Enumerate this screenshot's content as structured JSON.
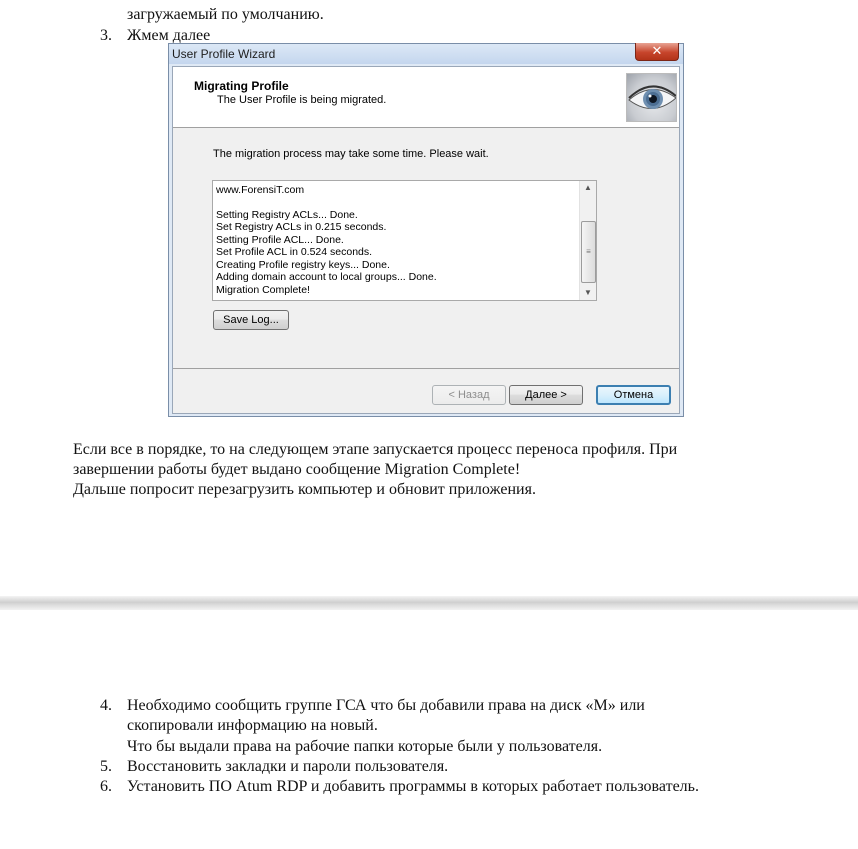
{
  "doc": {
    "top_partial_line": "загружаемый по умолчанию.",
    "step3": {
      "num": "3.",
      "text": "Жмем далее"
    },
    "para1": [
      "Если все в порядке, то на следующем этапе запускается процесс переноса профиля. При",
      "завершении работы будет выдано сообщение Migration Complete!",
      "Дальше попросит перезагрузить компьютер и обновит приложения."
    ],
    "step4": {
      "num": "4.",
      "lines": [
        "Необходимо сообщить группе ГСА что бы добавили права на диск «M» или",
        "скопировали информацию на новый.",
        " Что бы выдали права на рабочие папки которые были у пользователя."
      ]
    },
    "step5": {
      "num": "5.",
      "text": "Восстановить закладки и пароли пользователя."
    },
    "step6": {
      "num": "6.",
      "text": "Установить ПО Atum RDP и добавить программы в которых работает пользователь."
    }
  },
  "dialog": {
    "window_title": "User Profile Wizard",
    "close_glyph": "✕",
    "header_title": "Migrating Profile",
    "header_subtitle": "The User Profile is being migrated.",
    "header_image": "eye-icon",
    "info": "The migration process may take some time. Please wait.",
    "log_lines": [
      "www.ForensiT.com",
      "",
      "Setting Registry ACLs... Done.",
      "Set Registry ACLs in 0.215 seconds.",
      "Setting Profile ACL... Done.",
      "Set Profile ACL in 0.524 seconds.",
      "Creating Profile registry keys... Done.",
      "Adding domain account to local groups... Done.",
      "Migration Complete!"
    ],
    "save_log_label": "Save Log...",
    "back_label": "< Назад",
    "next_label": "Далее >",
    "cancel_label": "Отмена"
  }
}
